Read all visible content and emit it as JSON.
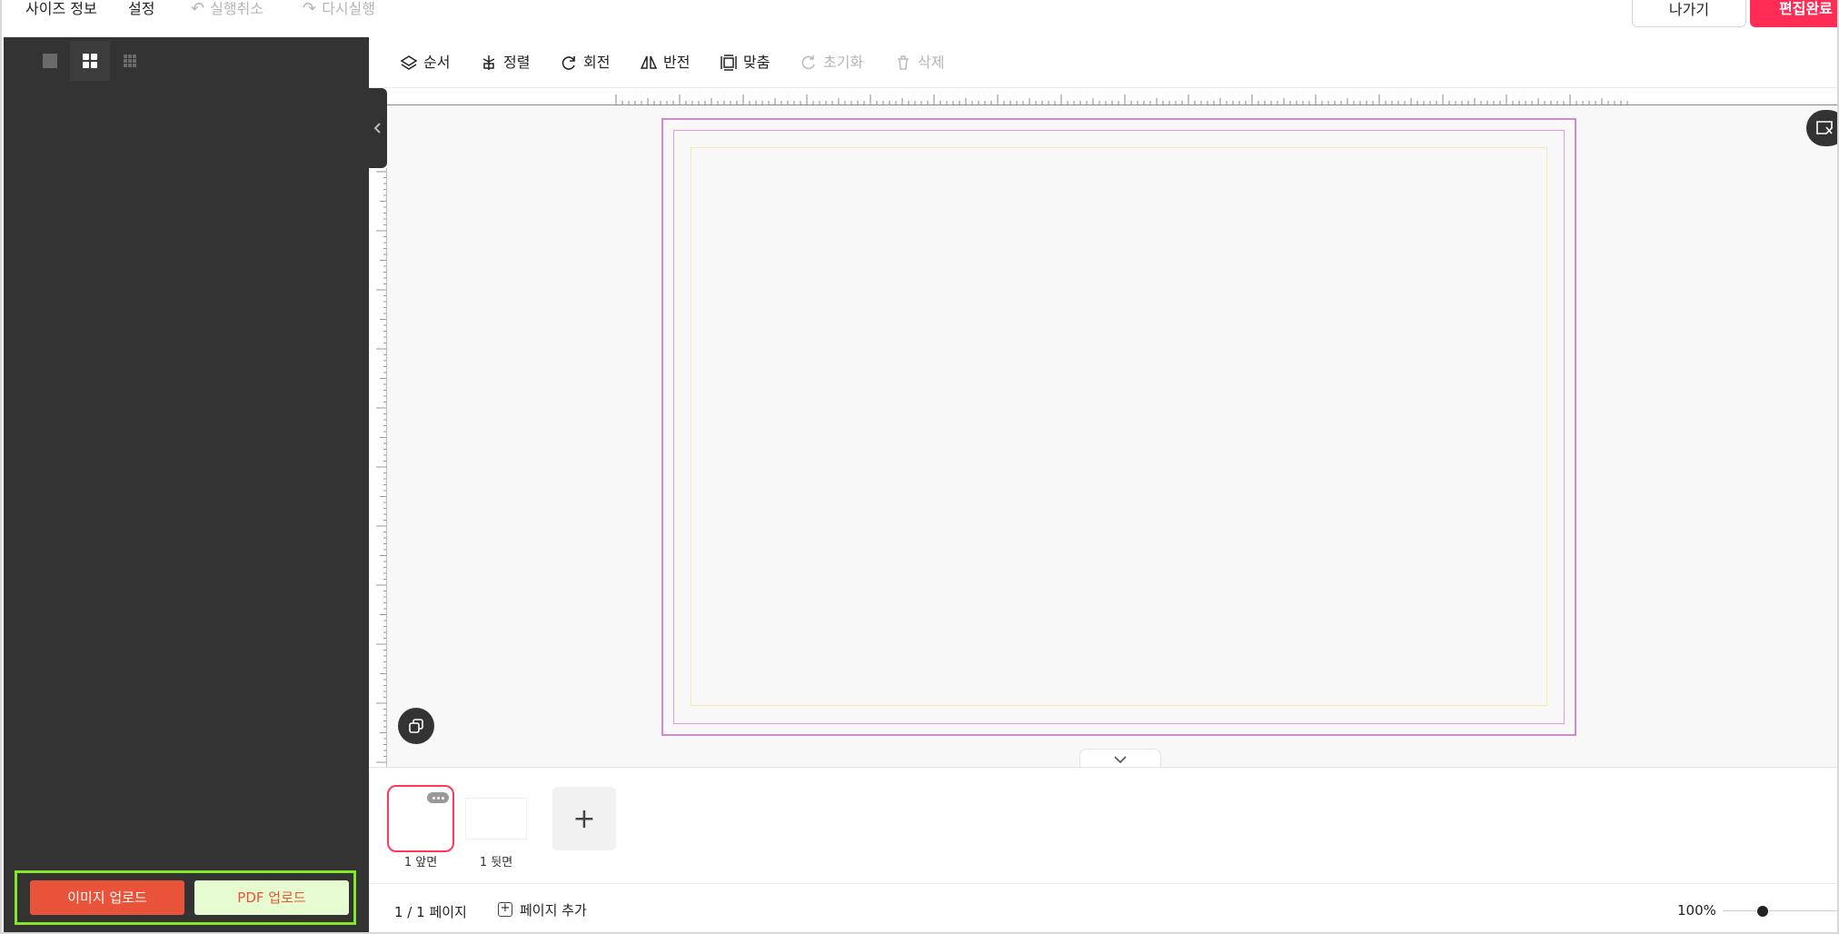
{
  "topbar": {
    "size_info": "사이즈 정보",
    "settings": "설정",
    "undo": "실행취소",
    "redo": "다시실행",
    "exit": "나가기",
    "done": "편집완료"
  },
  "colors": {
    "accent": "#ff2d55",
    "upload_image": "#e8533a",
    "upload_pdf_bg": "#e6fcd0",
    "highlight": "#86e62a",
    "sidebar_bg": "#333333",
    "trim_line": "#cf8ac9",
    "safe_line": "#f5eab0"
  },
  "sidebar": {
    "view_modes": [
      "single-view",
      "grid-2x2-view",
      "grid-3x3-view"
    ],
    "active_view": "grid-2x2-view",
    "image_upload": "이미지 업로드",
    "pdf_upload": "PDF 업로드"
  },
  "toolbar": {
    "order": "순서",
    "align": "정렬",
    "rotate": "회전",
    "flip": "반전",
    "fit": "맞춤",
    "reset": "초기화",
    "delete": "삭제"
  },
  "pages": {
    "thumbs": [
      {
        "label": "1 앞면",
        "selected": true
      },
      {
        "label": "1 뒷면",
        "selected": false
      }
    ],
    "add_symbol": "+"
  },
  "status": {
    "page_count": "1 / 1 페이지",
    "add_page": "페이지 추가",
    "zoom": "100%"
  }
}
